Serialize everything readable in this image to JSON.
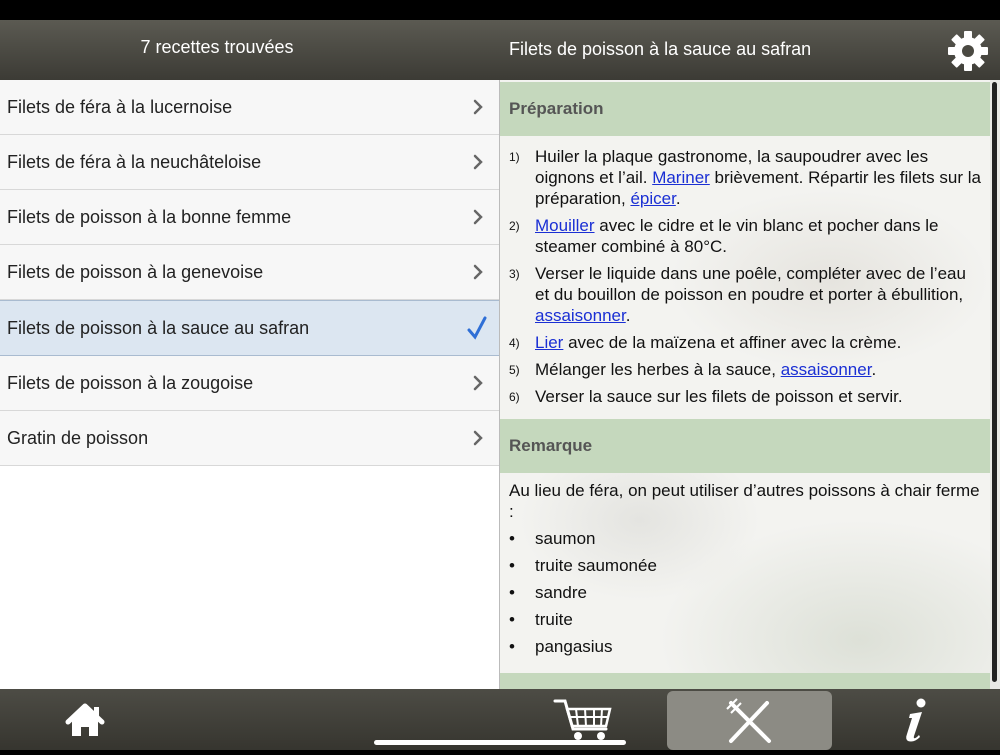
{
  "header": {
    "results_count": "7 recettes trouvées",
    "recipe_title": "Filets de poisson à la sauce au safran",
    "settings_icon": "gear-icon"
  },
  "recipes": [
    {
      "label": "Filets de féra à la lucernoise",
      "selected": false
    },
    {
      "label": "Filets de féra à la neuchâteloise",
      "selected": false
    },
    {
      "label": "Filets de poisson à la bonne femme",
      "selected": false
    },
    {
      "label": "Filets de poisson à la genevoise",
      "selected": false
    },
    {
      "label": "Filets de poisson à la sauce au safran",
      "selected": true
    },
    {
      "label": "Filets de poisson à la zougoise",
      "selected": false
    },
    {
      "label": "Gratin de poisson",
      "selected": false
    }
  ],
  "preparation": {
    "heading": "Préparation",
    "steps": [
      {
        "num": "1)",
        "parts": [
          {
            "text": "Huiler la plaque gastronome, la saupoudrer avec les oignons et l’ail. "
          },
          {
            "text": "Mariner",
            "link": true
          },
          {
            "text": " brièvement. Répartir les filets sur la préparation, "
          },
          {
            "text": "épicer",
            "link": true
          },
          {
            "text": "."
          }
        ]
      },
      {
        "num": "2)",
        "parts": [
          {
            "text": "Mouiller",
            "link": true
          },
          {
            "text": " avec le cidre et le vin blanc et pocher dans le steamer combiné à 80°C."
          }
        ]
      },
      {
        "num": "3)",
        "parts": [
          {
            "text": "Verser le liquide dans une poêle, compléter avec de l’eau et du bouillon de poisson en poudre et porter à ébullition, "
          },
          {
            "text": "assaisonner",
            "link": true
          },
          {
            "text": "."
          }
        ]
      },
      {
        "num": "4)",
        "parts": [
          {
            "text": "Lier",
            "link": true
          },
          {
            "text": " avec de la maïzena et affiner avec la crème."
          }
        ]
      },
      {
        "num": "5)",
        "parts": [
          {
            "text": "Mélanger les herbes à la sauce, "
          },
          {
            "text": "assaisonner",
            "link": true
          },
          {
            "text": "."
          }
        ]
      },
      {
        "num": "6)",
        "parts": [
          {
            "text": "Verser la sauce sur les filets de poisson et servir."
          }
        ]
      }
    ]
  },
  "remark": {
    "heading": "Remarque",
    "text": "Au lieu de féra, on peut utiliser d’autres poissons à chair ferme :",
    "bullet_symbol": "•",
    "items": [
      "saumon",
      "truite saumonée",
      "sandre",
      "truite",
      "pangasius"
    ]
  },
  "tabbar": {
    "tabs": [
      {
        "name": "home-icon",
        "active": false
      },
      {
        "name": "cart-icon",
        "active": false
      },
      {
        "name": "fork-knife-icon",
        "active": true
      },
      {
        "name": "info-icon",
        "active": false
      }
    ]
  },
  "colors": {
    "section_header": "#c5d8bd",
    "link": "#1a2fd4",
    "selected_row": "#dce6f1",
    "check": "#2f6fd6"
  }
}
